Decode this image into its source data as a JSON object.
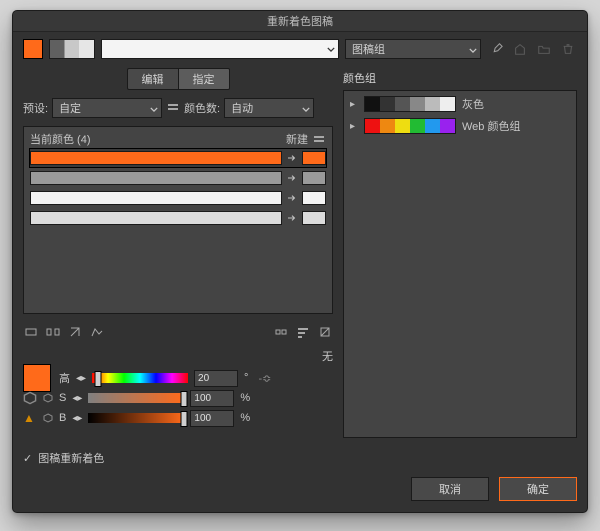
{
  "window": {
    "title": "重新着色图稿"
  },
  "topbar": {
    "active_color": "#ff6a1a",
    "artwork_group_label": "图稿组"
  },
  "tabs": {
    "edit": "编辑",
    "assign": "指定"
  },
  "preset": {
    "label": "预设:",
    "value": "自定",
    "count_label": "颜色数:",
    "count_value": "自动"
  },
  "card": {
    "current_label": "当前颜色 (4)",
    "new_label": "新建",
    "rows": [
      {
        "from": "#ff6a1a",
        "to": "#ff6a1a"
      },
      {
        "from": "#9a9a9a",
        "to": "#9a9a9a"
      },
      {
        "from": "#f4f4f4",
        "to": "#f4f4f4"
      },
      {
        "from": "#dcdcdc",
        "to": "#dcdcdc"
      }
    ]
  },
  "none_label": "无",
  "hsb": {
    "h_label": "高",
    "h_value": "20",
    "h_unit": "°",
    "s_label": "S",
    "s_value": "100",
    "s_unit": "%",
    "b_label": "B",
    "b_value": "100",
    "b_unit": "%"
  },
  "right": {
    "header": "颜色组",
    "groups": [
      {
        "name": "灰色",
        "strip": "gray"
      },
      {
        "name": "Web 颜色组",
        "strip": "web"
      }
    ]
  },
  "recolor": {
    "checked": true,
    "label": "图稿重新着色"
  },
  "footer": {
    "cancel": "取消",
    "ok": "确定"
  }
}
